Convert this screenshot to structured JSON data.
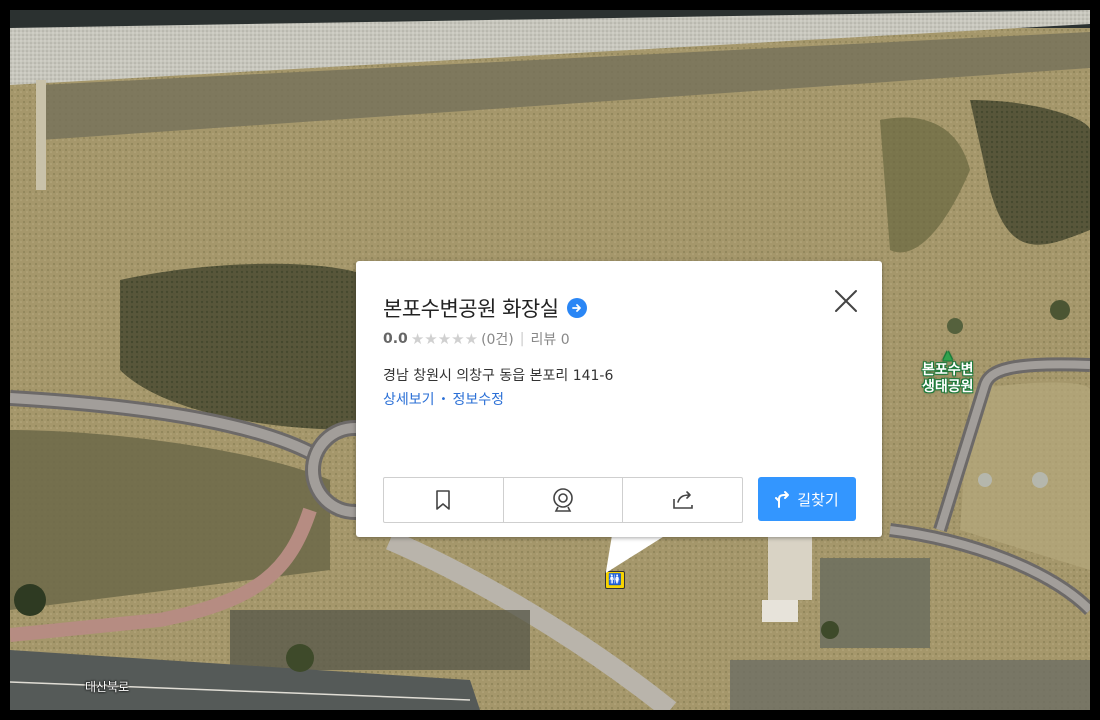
{
  "place": {
    "name": "본포수변공원 화장실",
    "score": "0.0",
    "stars": "★★★★★",
    "rating_count": "(0건)",
    "separator": "|",
    "review": "리뷰 0",
    "address": "경남 창원시 의창구 동읍 본포리 141-6",
    "link_detail": "상세보기",
    "link_dot": "•",
    "link_edit": "정보수정"
  },
  "actions": {
    "save_icon": "bookmark-icon",
    "roadview_icon": "roadview-icon",
    "share_icon": "share-icon",
    "directions_label": "길찾기"
  },
  "map": {
    "park_label_line1": "본포수변",
    "park_label_line2": "생태공원",
    "road_label": "대산북로",
    "marker_icon": "restroom-icon",
    "marker_glyph": "🚻"
  },
  "colors": {
    "accent": "#3396ff",
    "link": "#2a6fd6",
    "marker": "#f7d300"
  }
}
